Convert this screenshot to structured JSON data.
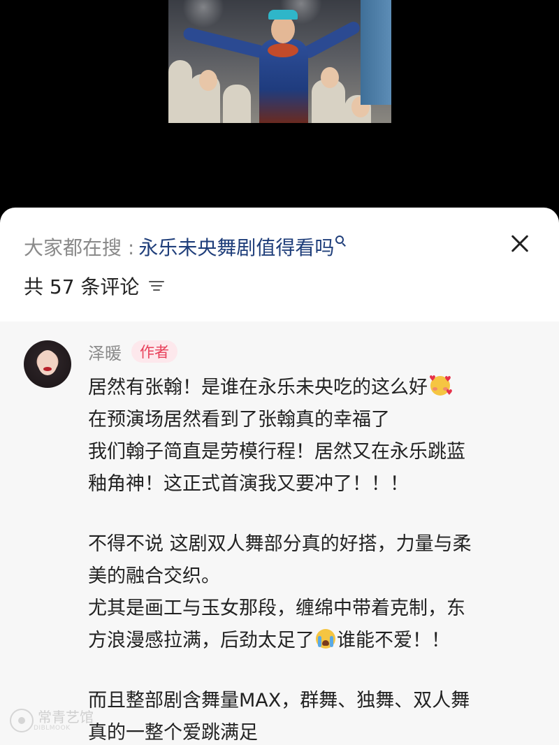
{
  "search": {
    "prefix": "大家都在搜 :",
    "query": "永乐未央舞剧值得看吗"
  },
  "comments_header": {
    "count_label": "共 57 条评论"
  },
  "comment": {
    "author": "泽暖",
    "badge": "作者",
    "lines": [
      "居然有张翰！是谁在永乐未央吃的这么好",
      "在预演场居然看到了张翰真的幸福了",
      "我们翰子简直是劳模行程！居然又在永乐跳蓝",
      "釉角神！这正式首演我又要冲了！！！",
      "不得不说 这剧双人舞部分真的好搭，力量与柔",
      "美的融合交织。",
      "尤其是画工与玉女那段，缠绵中带着克制，东",
      "方浪漫感拉满，后劲太足了",
      "谁能不爱！！",
      "而且整部剧含舞量MAX，群舞、独舞、双人舞",
      "真的一整个爱跳满足"
    ]
  },
  "watermark": {
    "name": "常青艺馆",
    "sub": "DIBLMOOK"
  },
  "colors": {
    "link": "#1f3e7a",
    "badge_text": "#e8405a",
    "badge_bg": "#fde8ec",
    "muted": "#8a8a8a"
  }
}
